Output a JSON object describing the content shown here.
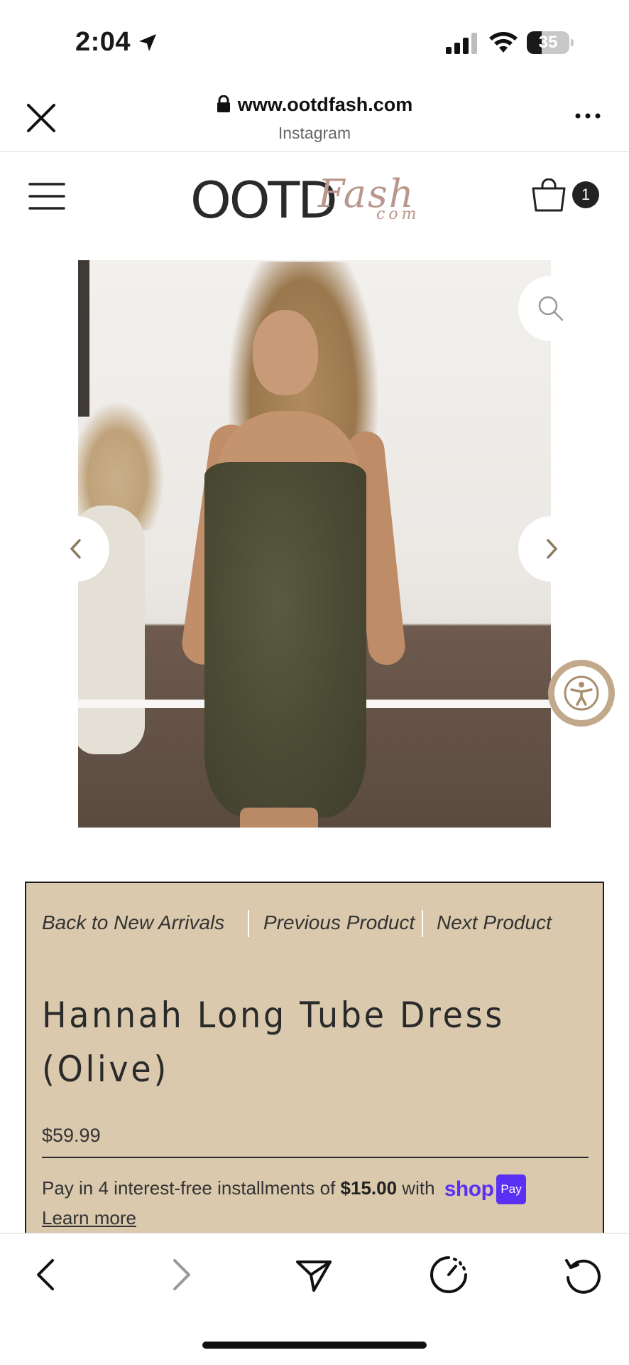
{
  "status_bar": {
    "time": "2:04",
    "battery_percent": "35",
    "battery_level": 0.35,
    "icons": [
      "location-arrow-icon",
      "cellular-signal-icon",
      "wifi-icon",
      "battery-icon"
    ]
  },
  "browser": {
    "url": "www.ootdfash.com",
    "source": "Instagram",
    "close_icon": "close-icon",
    "more_icon": "more-options-icon"
  },
  "site_header": {
    "logo_main": "OOTD",
    "logo_script": "Fash",
    "logo_sub": "com",
    "cart_count": "1",
    "menu_icon": "hamburger-menu-icon",
    "cart_icon": "shopping-bag-icon"
  },
  "gallery": {
    "zoom_icon": "magnifier-icon",
    "prev_icon": "chevron-left-icon",
    "next_icon": "chevron-right-icon",
    "accessibility_icon": "accessibility-person-icon"
  },
  "product": {
    "breadcrumbs": {
      "back": "Back to New Arrivals",
      "previous": "Previous Product",
      "next": "Next Product"
    },
    "title_line1": "Hannah Long Tube Dress",
    "title_line2": "(Olive)",
    "price": "$59.99",
    "installments": {
      "prefix": "Pay in 4 interest-free installments of ",
      "amount": "$15.00",
      "suffix": " with ",
      "shop_word": "shop",
      "pay_badge": "Pay",
      "learn_more": "Learn more"
    }
  },
  "colors": {
    "card_background": "#dac9ad",
    "shop_pay_purple": "#5a31f4",
    "accessibility_ring": "#c2a98c",
    "logo_accent": "#b9978c"
  },
  "toolbar": {
    "icons": [
      "back-arrow-icon",
      "forward-arrow-icon",
      "share-send-icon",
      "timer-icon",
      "reload-icon"
    ]
  }
}
